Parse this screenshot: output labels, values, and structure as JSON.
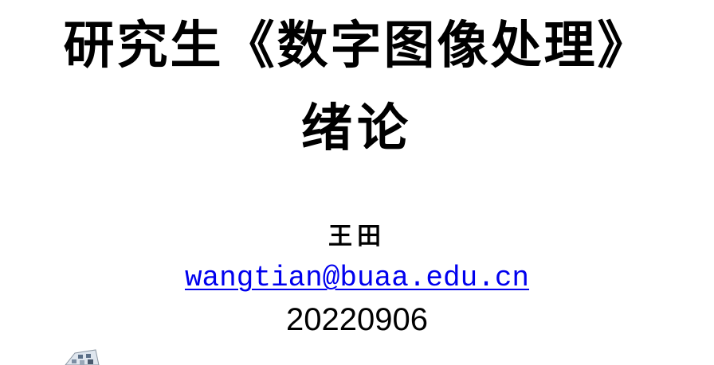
{
  "slide": {
    "title_line1": "研究生《数字图像处理》",
    "title_line2": "绪论",
    "author": "王田",
    "email": "wangtian@buaa.edu.cn",
    "date": "20220906"
  },
  "logo": {
    "icon": "building-logo-icon"
  },
  "colors": {
    "link": "#0000ee",
    "text": "#000000",
    "background": "#ffffff"
  }
}
